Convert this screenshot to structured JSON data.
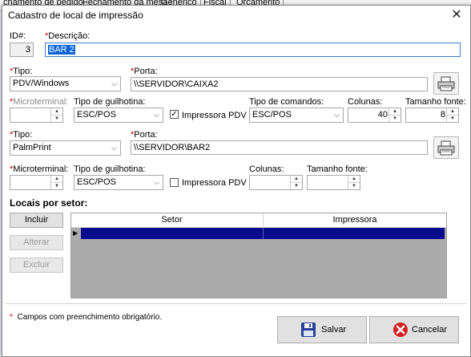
{
  "background_tabs": [
    "chamento de pedido",
    "Fechamento da mesa",
    "Genérico",
    "Fiscal",
    "Orçamento"
  ],
  "dialog": {
    "title": "Cadastro de local de impressão",
    "close_glyph": "✕"
  },
  "id_label": "ID#:",
  "id_value": "3",
  "descricao_label": "Descrição:",
  "descricao_value": "BAR 2",
  "required_mark": "*",
  "row1": {
    "tipo_label": "Tipo:",
    "tipo_value": "PDV/Windows",
    "porta_label": "Porta:",
    "porta_value": "\\\\SERVIDOR\\CAIXA2",
    "microterminal_label": "Microterminal:",
    "guilhotina_label": "Tipo de guilhotina:",
    "guilhotina_value": "ESC/POS",
    "impressora_pdv_label": "Impressora PDV",
    "impressora_pdv_checked": true,
    "comandos_label": "Tipo de comandos:",
    "comandos_value": "ESC/POS",
    "colunas_label": "Colunas:",
    "colunas_value": "40",
    "fonte_label": "Tamanho fonte:",
    "fonte_value": "8"
  },
  "row2": {
    "tipo_label": "Tipo:",
    "tipo_value": "PalmPrint",
    "porta_label": "Porta:",
    "porta_value": "\\\\SERVIDOR\\BAR2",
    "microterminal_label": "Microterminal:",
    "guilhotina_label": "Tipo de guilhotina:",
    "guilhotina_value": "ESC/POS",
    "impressora_pdv_label": "Impressora PDV",
    "impressora_pdv_checked": false,
    "colunas_label": "Colunas:",
    "fonte_label": "Tamanho fonte:"
  },
  "locais": {
    "heading": "Locais por setor:",
    "incluir": "Incluir",
    "alterar": "Alterar",
    "excluir": "Excluir",
    "columns": [
      "Setor",
      "Impressora"
    ]
  },
  "footer": {
    "note": "Campos com preenchimento obrigatório.",
    "salvar": "Salvar",
    "cancelar": "Cancelar"
  },
  "icons": {
    "printer": "printer-icon",
    "save": "floppy-disk-icon",
    "cancel": "cancel-icon"
  },
  "colors": {
    "required": "#d00000",
    "selection": "#0a0a8c",
    "cancel_icon": "#d32020",
    "save_icon": "#2a3f9a"
  }
}
